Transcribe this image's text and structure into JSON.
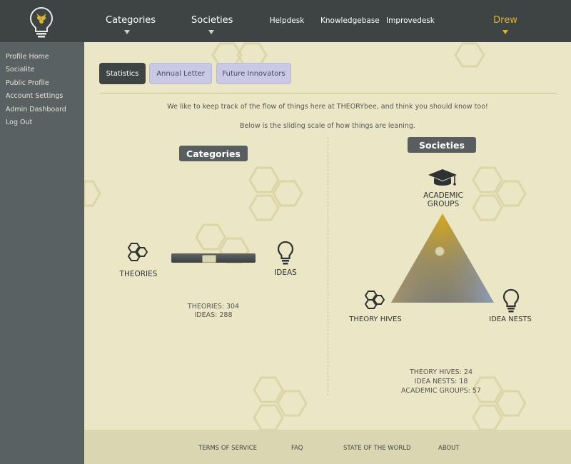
{
  "nav": {
    "categories": "Categories",
    "societies": "Societies",
    "helpdesk": "Helpdesk",
    "knowledgebase": "Knowledgebase",
    "improvedesk": "Improvedesk",
    "user": "Drew"
  },
  "sidebar": {
    "items": [
      "Profile Home",
      "Socialite",
      "Public Profile",
      "Account Settings",
      "Admin Dashboard",
      "Log Out"
    ]
  },
  "tabs": {
    "statistics": "Statistics",
    "annual_letter": "Annual Letter",
    "future_innovators": "Future Innovators"
  },
  "intro": {
    "line1": "We like to keep track of the flow of things here at THEORYbee, and think you should know too!",
    "line2": "Below is the sliding scale of how things are leaning."
  },
  "categories": {
    "heading": "Categories",
    "left_label": "THEORIES",
    "right_label": "IDEAS",
    "slider_value": 0.44,
    "stats": [
      "THEORIES: 304",
      "IDEAS: 288"
    ]
  },
  "societies": {
    "heading": "Societies",
    "top_label_line1": "ACADEMIC",
    "top_label_line2": "GROUPS",
    "left_label": "THEORY HIVES",
    "right_label": "IDEA NESTS",
    "stats": [
      "THEORY HIVES: 24",
      "IDEA NESTS: 18",
      "ACADEMIC GROUPS: 57"
    ]
  },
  "footer": {
    "terms": "TERMS OF SERVICE",
    "faq": "FAQ",
    "state": "STATE OF THE WORLD",
    "about": "ABOUT"
  },
  "colors": {
    "topbar": "#3e4444",
    "sidebar": "#5a6162",
    "background": "#ebe7c6",
    "accent_gold": "#e0b52a",
    "tab_inactive": "#c9c9e6"
  },
  "icons": [
    "bulb-logo-icon",
    "hexagon-cluster-icon",
    "lightbulb-icon",
    "graduation-cap-icon"
  ]
}
